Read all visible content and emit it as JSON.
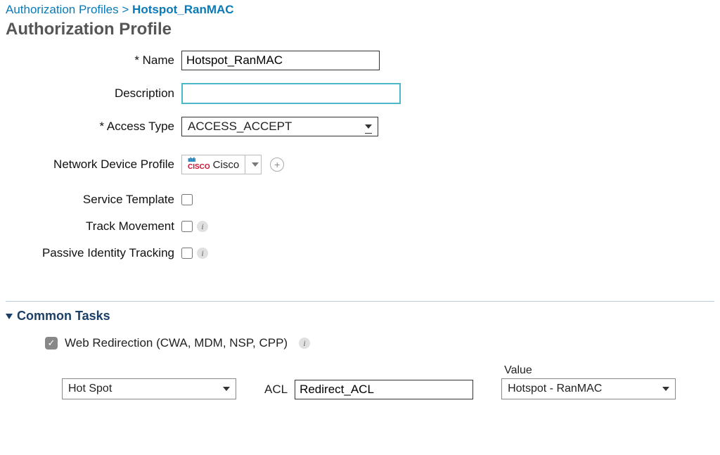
{
  "breadcrumb": {
    "parent": "Authorization Profiles",
    "separator": ">",
    "current": "Hotspot_RanMAC"
  },
  "title": "Authorization Profile",
  "fields": {
    "name": {
      "label": "* Name",
      "value": "Hotspot_RanMAC"
    },
    "description": {
      "label": "Description",
      "value": ""
    },
    "access_type": {
      "label": "* Access Type",
      "selected": "ACCESS_ACCEPT"
    },
    "network_device_profile": {
      "label": "Network Device Profile",
      "selected": "Cisco",
      "logo": "cisco"
    },
    "service_template": {
      "label": "Service Template",
      "checked": false
    },
    "track_movement": {
      "label": "Track Movement",
      "checked": false
    },
    "passive_identity_tracking": {
      "label": "Passive Identity Tracking",
      "checked": false
    }
  },
  "common_tasks": {
    "title": "Common Tasks",
    "web_redirection": {
      "label": "Web Redirection (CWA, MDM, NSP, CPP)",
      "checked": true,
      "type": "Hot Spot",
      "acl_label": "ACL",
      "acl_value": "Redirect_ACL",
      "value_label": "Value",
      "value_selected": "Hotspot - RanMAC"
    }
  }
}
